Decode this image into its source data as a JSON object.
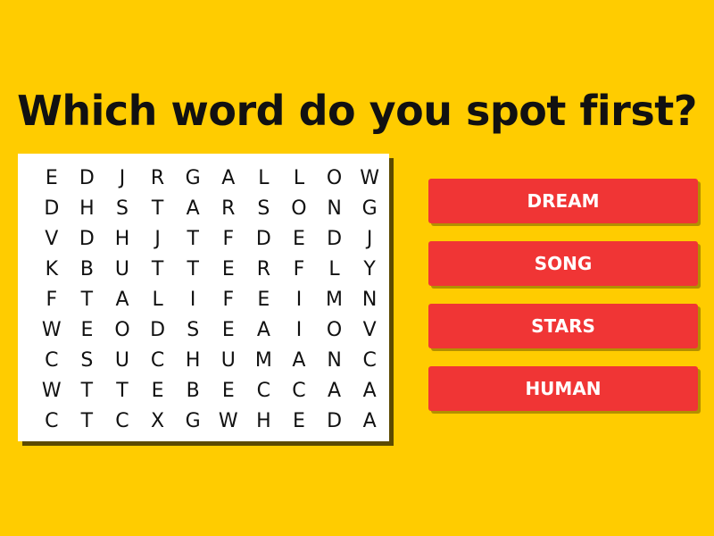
{
  "title": "Which word do you spot first?",
  "grid": [
    [
      "E",
      "D",
      "J",
      "R",
      "G",
      "A",
      "L",
      "L",
      "O",
      "W"
    ],
    [
      "D",
      "H",
      "S",
      "T",
      "A",
      "R",
      "S",
      "O",
      "N",
      "G"
    ],
    [
      "V",
      "D",
      "H",
      "J",
      "T",
      "F",
      "D",
      "E",
      "D",
      "J"
    ],
    [
      "K",
      "B",
      "U",
      "T",
      "T",
      "E",
      "R",
      "F",
      "L",
      "Y"
    ],
    [
      "F",
      "T",
      "A",
      "L",
      "I",
      "F",
      "E",
      "I",
      "M",
      "N"
    ],
    [
      "W",
      "E",
      "O",
      "D",
      "S",
      "E",
      "A",
      "I",
      "O",
      "V"
    ],
    [
      "C",
      "S",
      "U",
      "C",
      "H",
      "U",
      "M",
      "A",
      "N",
      "C"
    ],
    [
      "W",
      "T",
      "T",
      "E",
      "B",
      "E",
      "C",
      "C",
      "A",
      "A"
    ],
    [
      "C",
      "T",
      "C",
      "X",
      "G",
      "W",
      "H",
      "E",
      "D",
      "A"
    ]
  ],
  "options": [
    {
      "label": "DREAM"
    },
    {
      "label": "SONG"
    },
    {
      "label": "STARS"
    },
    {
      "label": "HUMAN"
    }
  ],
  "colors": {
    "background": "#FFCC00",
    "button": "#F03535",
    "button_text": "#FFFFFF",
    "title_text": "#111111"
  }
}
